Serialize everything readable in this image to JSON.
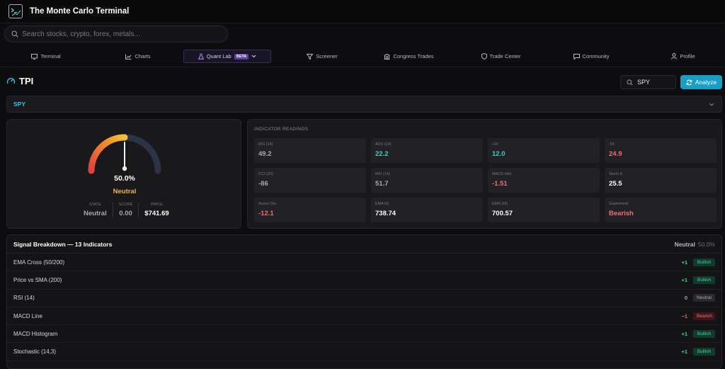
{
  "app": {
    "title": "The Monte Carlo Terminal"
  },
  "search": {
    "placeholder": "Search stocks, crypto, forex, metals..."
  },
  "nav": {
    "items": [
      {
        "label": "Terminal",
        "icon": "monitor-icon"
      },
      {
        "label": "Charts",
        "icon": "chart-icon"
      },
      {
        "label": "Quant Lab",
        "icon": "flask-icon",
        "badge": "BETA",
        "active": true
      },
      {
        "label": "Screener",
        "icon": "filter-icon"
      },
      {
        "label": "Congress Trades",
        "icon": "capitol-icon"
      },
      {
        "label": "Trade Center",
        "icon": "shield-icon"
      },
      {
        "label": "Community",
        "icon": "chat-icon"
      },
      {
        "label": "Profile",
        "icon": "user-icon"
      }
    ]
  },
  "page": {
    "title": "TPI",
    "symbol_value": "SPY",
    "analyze_label": "Analyze",
    "selected_symbol": "SPY"
  },
  "gauge": {
    "percent": "50.0%",
    "level": 0.5,
    "state": "Neutral",
    "stats": [
      {
        "label": "STATE",
        "value": "Neutral"
      },
      {
        "label": "SCORE",
        "value": "0.00"
      },
      {
        "label": "PRICE",
        "value": "$741.69"
      }
    ]
  },
  "indicators": {
    "title": "INDICATOR READINGS",
    "tiles": [
      {
        "label": "RSI (14)",
        "value": "49.2",
        "color": "#a9a9ae"
      },
      {
        "label": "ADX (14)",
        "value": "22.2",
        "color": "#3ed0c4"
      },
      {
        "label": "+DI",
        "value": "12.0",
        "color": "#3ed0c4"
      },
      {
        "label": "-DI",
        "value": "24.9",
        "color": "#f06d71"
      },
      {
        "label": "CCI (20)",
        "value": "-86",
        "color": "#a9a9ae"
      },
      {
        "label": "MFI (14)",
        "value": "51.7",
        "color": "#a9a9ae"
      },
      {
        "label": "MACD Hist",
        "value": "-1.51",
        "color": "#f06d71"
      },
      {
        "label": "Stoch K",
        "value": "25.5",
        "color": "#ffffff"
      },
      {
        "label": "Aroon Osc",
        "value": "-12.1",
        "color": "#f06d71"
      },
      {
        "label": "EMA 50",
        "value": "738.74",
        "color": "#ffffff"
      },
      {
        "label": "EMA 200",
        "value": "700.57",
        "color": "#ffffff"
      },
      {
        "label": "Supertrend",
        "value": "Bearish",
        "color": "#f06d71"
      }
    ]
  },
  "breakdown": {
    "title": "Signal Breakdown — 13 Indicators",
    "state": "Neutral",
    "percent": "50.0%",
    "rows": [
      {
        "name": "EMA Cross (50/200)",
        "score": "+1",
        "signal": "Bullish"
      },
      {
        "name": "Price vs SMA (200)",
        "score": "+1",
        "signal": "Bullish"
      },
      {
        "name": "RSI (14)",
        "score": "0",
        "signal": "Neutral"
      },
      {
        "name": "MACD Line",
        "score": "−1",
        "signal": "Bearish"
      },
      {
        "name": "MACD Histogram",
        "score": "+1",
        "signal": "Bullish"
      },
      {
        "name": "Stochastic (14,3)",
        "score": "+1",
        "signal": "Bullish"
      }
    ]
  },
  "colors": {
    "accent": "#1a9fc4",
    "bullish": "#47d69a",
    "bearish": "#f06d71",
    "neutral_state": "#e8b43b"
  }
}
